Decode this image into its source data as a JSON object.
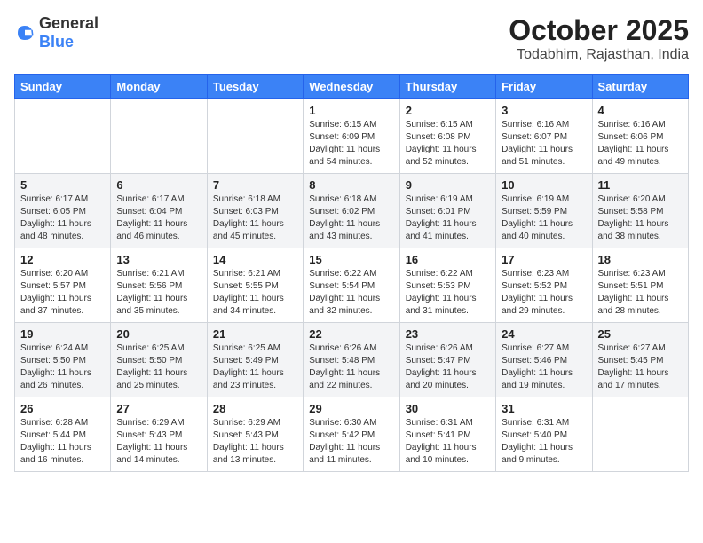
{
  "header": {
    "logo_general": "General",
    "logo_blue": "Blue",
    "month_year": "October 2025",
    "location": "Todabhim, Rajasthan, India"
  },
  "days_of_week": [
    "Sunday",
    "Monday",
    "Tuesday",
    "Wednesday",
    "Thursday",
    "Friday",
    "Saturday"
  ],
  "weeks": [
    [
      {
        "day": "",
        "info": ""
      },
      {
        "day": "",
        "info": ""
      },
      {
        "day": "",
        "info": ""
      },
      {
        "day": "1",
        "info": "Sunrise: 6:15 AM\nSunset: 6:09 PM\nDaylight: 11 hours\nand 54 minutes."
      },
      {
        "day": "2",
        "info": "Sunrise: 6:15 AM\nSunset: 6:08 PM\nDaylight: 11 hours\nand 52 minutes."
      },
      {
        "day": "3",
        "info": "Sunrise: 6:16 AM\nSunset: 6:07 PM\nDaylight: 11 hours\nand 51 minutes."
      },
      {
        "day": "4",
        "info": "Sunrise: 6:16 AM\nSunset: 6:06 PM\nDaylight: 11 hours\nand 49 minutes."
      }
    ],
    [
      {
        "day": "5",
        "info": "Sunrise: 6:17 AM\nSunset: 6:05 PM\nDaylight: 11 hours\nand 48 minutes."
      },
      {
        "day": "6",
        "info": "Sunrise: 6:17 AM\nSunset: 6:04 PM\nDaylight: 11 hours\nand 46 minutes."
      },
      {
        "day": "7",
        "info": "Sunrise: 6:18 AM\nSunset: 6:03 PM\nDaylight: 11 hours\nand 45 minutes."
      },
      {
        "day": "8",
        "info": "Sunrise: 6:18 AM\nSunset: 6:02 PM\nDaylight: 11 hours\nand 43 minutes."
      },
      {
        "day": "9",
        "info": "Sunrise: 6:19 AM\nSunset: 6:01 PM\nDaylight: 11 hours\nand 41 minutes."
      },
      {
        "day": "10",
        "info": "Sunrise: 6:19 AM\nSunset: 5:59 PM\nDaylight: 11 hours\nand 40 minutes."
      },
      {
        "day": "11",
        "info": "Sunrise: 6:20 AM\nSunset: 5:58 PM\nDaylight: 11 hours\nand 38 minutes."
      }
    ],
    [
      {
        "day": "12",
        "info": "Sunrise: 6:20 AM\nSunset: 5:57 PM\nDaylight: 11 hours\nand 37 minutes."
      },
      {
        "day": "13",
        "info": "Sunrise: 6:21 AM\nSunset: 5:56 PM\nDaylight: 11 hours\nand 35 minutes."
      },
      {
        "day": "14",
        "info": "Sunrise: 6:21 AM\nSunset: 5:55 PM\nDaylight: 11 hours\nand 34 minutes."
      },
      {
        "day": "15",
        "info": "Sunrise: 6:22 AM\nSunset: 5:54 PM\nDaylight: 11 hours\nand 32 minutes."
      },
      {
        "day": "16",
        "info": "Sunrise: 6:22 AM\nSunset: 5:53 PM\nDaylight: 11 hours\nand 31 minutes."
      },
      {
        "day": "17",
        "info": "Sunrise: 6:23 AM\nSunset: 5:52 PM\nDaylight: 11 hours\nand 29 minutes."
      },
      {
        "day": "18",
        "info": "Sunrise: 6:23 AM\nSunset: 5:51 PM\nDaylight: 11 hours\nand 28 minutes."
      }
    ],
    [
      {
        "day": "19",
        "info": "Sunrise: 6:24 AM\nSunset: 5:50 PM\nDaylight: 11 hours\nand 26 minutes."
      },
      {
        "day": "20",
        "info": "Sunrise: 6:25 AM\nSunset: 5:50 PM\nDaylight: 11 hours\nand 25 minutes."
      },
      {
        "day": "21",
        "info": "Sunrise: 6:25 AM\nSunset: 5:49 PM\nDaylight: 11 hours\nand 23 minutes."
      },
      {
        "day": "22",
        "info": "Sunrise: 6:26 AM\nSunset: 5:48 PM\nDaylight: 11 hours\nand 22 minutes."
      },
      {
        "day": "23",
        "info": "Sunrise: 6:26 AM\nSunset: 5:47 PM\nDaylight: 11 hours\nand 20 minutes."
      },
      {
        "day": "24",
        "info": "Sunrise: 6:27 AM\nSunset: 5:46 PM\nDaylight: 11 hours\nand 19 minutes."
      },
      {
        "day": "25",
        "info": "Sunrise: 6:27 AM\nSunset: 5:45 PM\nDaylight: 11 hours\nand 17 minutes."
      }
    ],
    [
      {
        "day": "26",
        "info": "Sunrise: 6:28 AM\nSunset: 5:44 PM\nDaylight: 11 hours\nand 16 minutes."
      },
      {
        "day": "27",
        "info": "Sunrise: 6:29 AM\nSunset: 5:43 PM\nDaylight: 11 hours\nand 14 minutes."
      },
      {
        "day": "28",
        "info": "Sunrise: 6:29 AM\nSunset: 5:43 PM\nDaylight: 11 hours\nand 13 minutes."
      },
      {
        "day": "29",
        "info": "Sunrise: 6:30 AM\nSunset: 5:42 PM\nDaylight: 11 hours\nand 11 minutes."
      },
      {
        "day": "30",
        "info": "Sunrise: 6:31 AM\nSunset: 5:41 PM\nDaylight: 11 hours\nand 10 minutes."
      },
      {
        "day": "31",
        "info": "Sunrise: 6:31 AM\nSunset: 5:40 PM\nDaylight: 11 hours\nand 9 minutes."
      },
      {
        "day": "",
        "info": ""
      }
    ]
  ]
}
